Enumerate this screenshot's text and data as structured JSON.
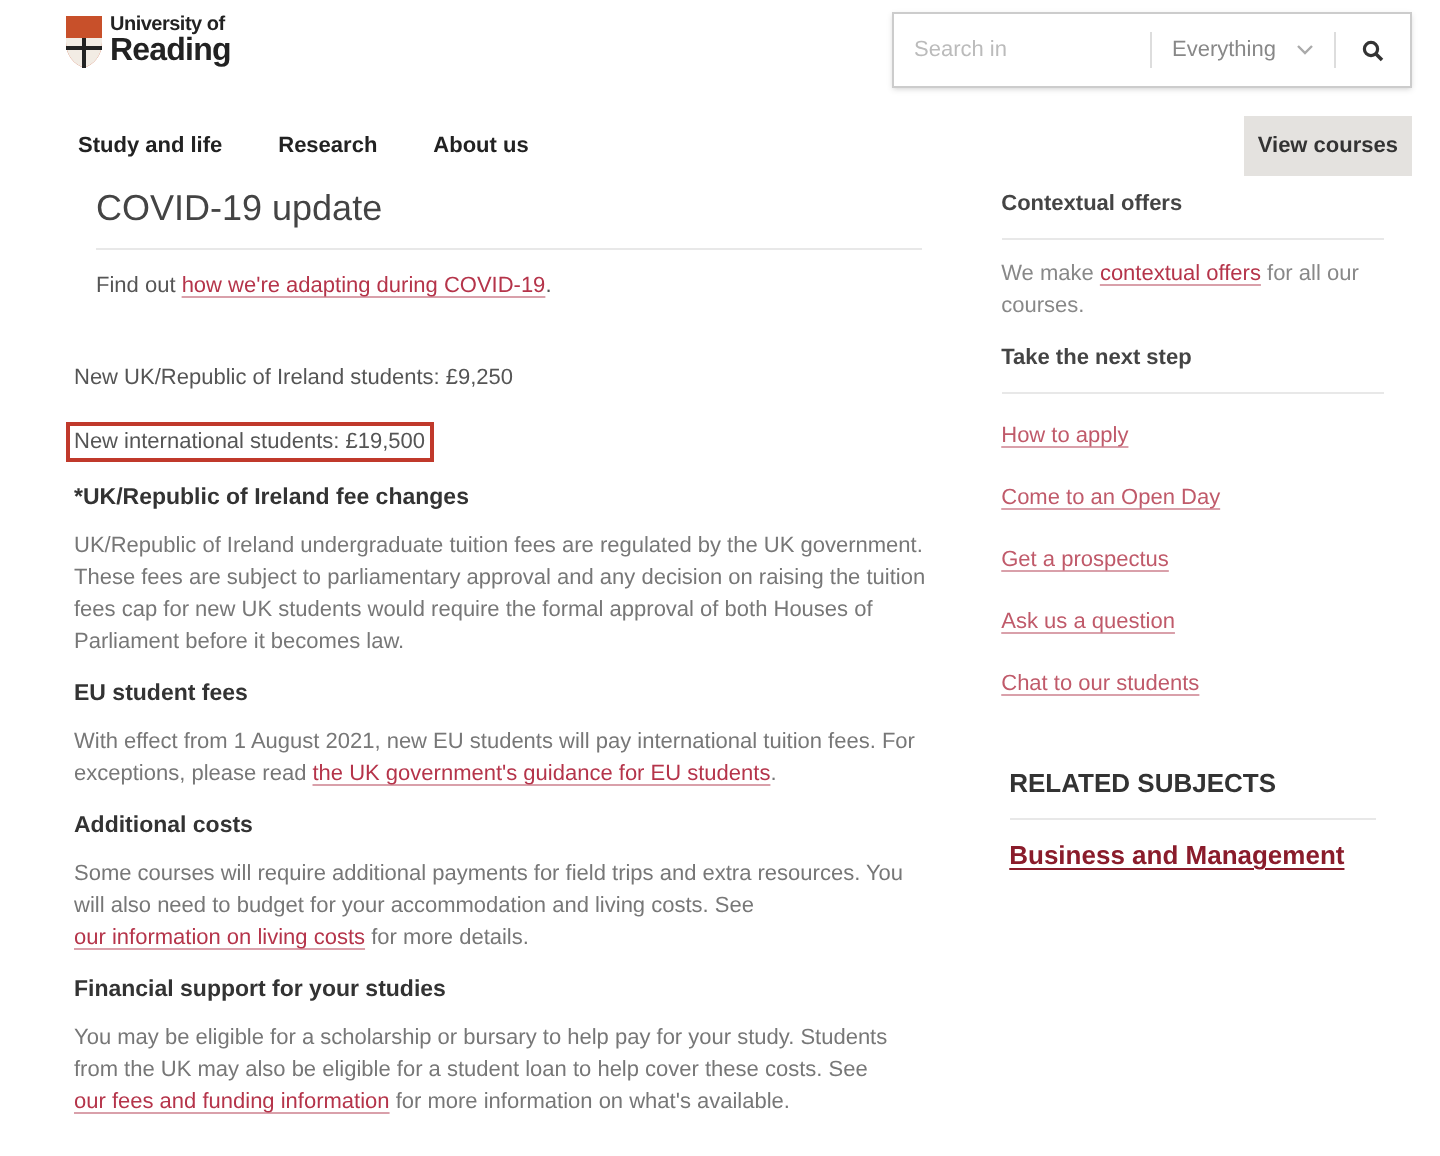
{
  "logo": {
    "line1": "University of",
    "line2": "Reading"
  },
  "search": {
    "placeholder": "Search in",
    "scope": "Everything"
  },
  "nav": [
    {
      "label": "Study and life"
    },
    {
      "label": "Research"
    },
    {
      "label": "About us"
    }
  ],
  "cta": "View courses",
  "covid": {
    "title": "COVID-19 update",
    "text": [
      {
        "text": "Find out "
      },
      {
        "text": "how we're adapting during COVID-19",
        "link": true
      },
      {
        "text": "."
      }
    ]
  },
  "fees": [
    {
      "text": "New UK/Republic of Ireland students: £9,250",
      "highlighted": false
    },
    {
      "text": "New international students: £19,500",
      "highlighted": true
    }
  ],
  "sections": [
    {
      "heading": "*UK/Republic of Ireland fee changes",
      "body": [
        {
          "text": "UK/Republic of Ireland undergraduate tuition fees are regulated by the UK government. These fees are subject to parliamentary approval and any decision on raising the tuition fees cap for new UK students would require the formal approval of both Houses of Parliament before it becomes law."
        }
      ]
    },
    {
      "heading": "EU student fees",
      "body": [
        {
          "text": "With effect from 1 August 2021, new EU students will pay international tuition fees. For exceptions, please read "
        },
        {
          "text": "the UK government's guidance for EU students",
          "link": true
        },
        {
          "text": "."
        }
      ]
    },
    {
      "heading": "Additional costs",
      "body": [
        {
          "text": "Some courses will require additional payments for field trips and extra resources. You will also need to budget for your accommodation and living costs. See "
        },
        {
          "text": "our information on living costs",
          "link": true
        },
        {
          "text": " for more details."
        }
      ]
    },
    {
      "heading": "Financial support for your studies",
      "body": [
        {
          "text": "You may be eligible for a scholarship or bursary to help pay for your study. Students from the UK may also be eligible for a student loan to help cover these costs. See "
        },
        {
          "text": "our fees and funding information",
          "link": true
        },
        {
          "text": " for more information on what's available."
        }
      ]
    }
  ],
  "sidebar": {
    "contextual": {
      "heading": "Contextual offers",
      "text": [
        {
          "text": "We make "
        },
        {
          "text": "contextual offers",
          "link": true
        },
        {
          "text": " for all our courses."
        }
      ]
    },
    "next_step": {
      "heading": "Take the next step",
      "links": [
        "How to apply",
        "Come to an Open Day",
        "Get a prospectus",
        "Ask us a question",
        "Chat to our students"
      ]
    },
    "related": {
      "heading": "RELATED SUBJECTS",
      "links": [
        "Business and Management"
      ]
    }
  }
}
